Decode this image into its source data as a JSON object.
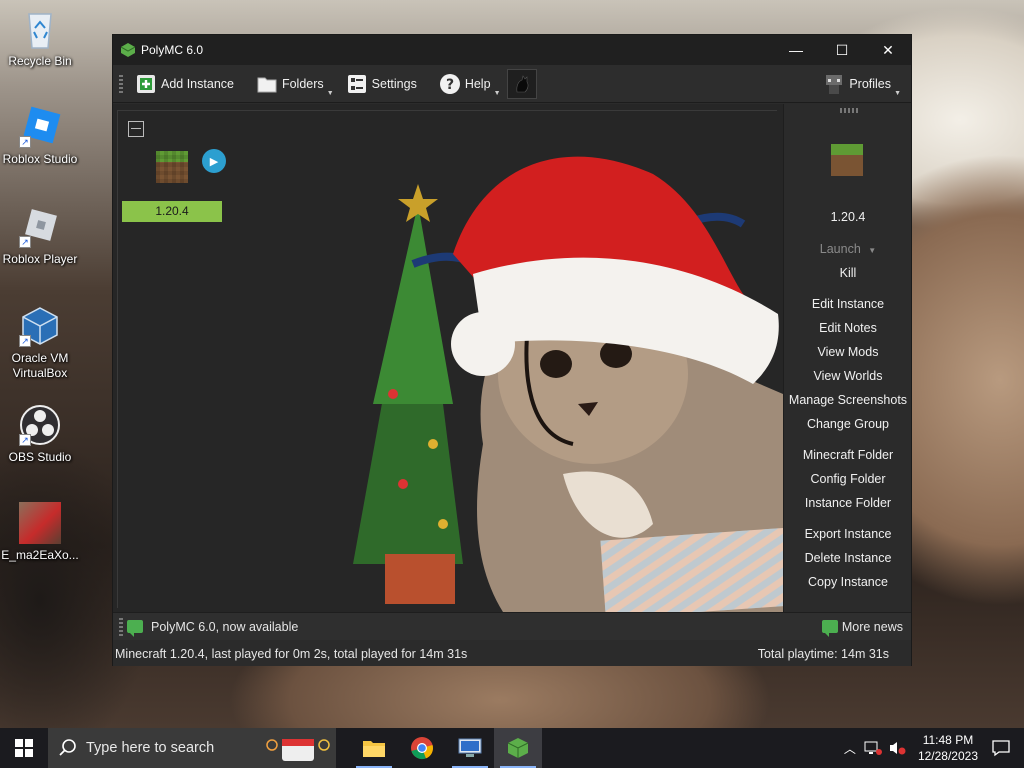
{
  "desktop": {
    "icons": [
      {
        "label": "Recycle Bin"
      },
      {
        "label": "Roblox Studio"
      },
      {
        "label": "Roblox Player"
      },
      {
        "label": "Oracle VM VirtualBox"
      },
      {
        "label": "OBS Studio"
      },
      {
        "label": "E_ma2EaXo..."
      }
    ]
  },
  "window": {
    "title": "PolyMC 6.0",
    "controls": {
      "minimize": "—",
      "maximize": "☐",
      "close": "✕"
    }
  },
  "toolbar": {
    "add_instance": "Add Instance",
    "folders": "Folders",
    "settings": "Settings",
    "help": "Help",
    "profiles": "Profiles"
  },
  "instances": [
    {
      "name": "1.20.4",
      "selected": true
    }
  ],
  "sidebar": {
    "instance_name": "1.20.4",
    "launch": "Launch",
    "kill": "Kill",
    "edit_instance": "Edit Instance",
    "edit_notes": "Edit Notes",
    "view_mods": "View Mods",
    "view_worlds": "View Worlds",
    "manage_screenshots": "Manage Screenshots",
    "change_group": "Change Group",
    "minecraft_folder": "Minecraft Folder",
    "config_folder": "Config Folder",
    "instance_folder": "Instance Folder",
    "export_instance": "Export Instance",
    "delete_instance": "Delete Instance",
    "copy_instance": "Copy Instance"
  },
  "news": {
    "headline": "PolyMC 6.0, now available",
    "more_news": "More news"
  },
  "status": {
    "left": "Minecraft 1.20.4, last played for 0m 2s, total played for 14m 31s",
    "right": "Total playtime: 14m 31s"
  },
  "taskbar": {
    "search_placeholder": "Type here to search",
    "time": "11:48 PM",
    "date": "12/28/2023"
  },
  "colors": {
    "instance_selected": "#8bc34a",
    "window_bg": "#2b2b2b",
    "taskbar_bg": "#1b1b1f"
  }
}
